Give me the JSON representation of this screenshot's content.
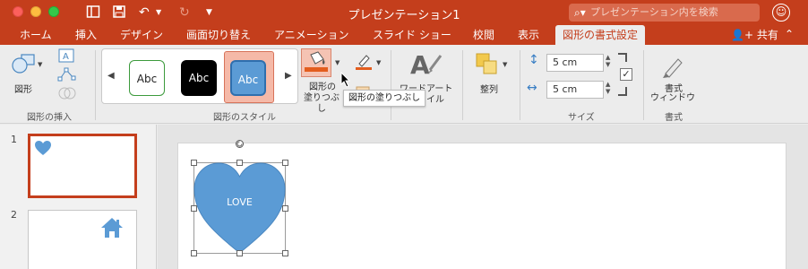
{
  "window": {
    "title": "プレゼンテーション1",
    "search_placeholder": "プレゼンテーション内を検索"
  },
  "tabs": [
    {
      "label": "ホーム"
    },
    {
      "label": "挿入"
    },
    {
      "label": "デザイン"
    },
    {
      "label": "画面切り替え"
    },
    {
      "label": "アニメーション"
    },
    {
      "label": "スライド ショー"
    },
    {
      "label": "校閲"
    },
    {
      "label": "表示"
    },
    {
      "label": "図形の書式設定",
      "active": true
    }
  ],
  "share_label": "共有",
  "ribbon": {
    "insert_group": {
      "shape_label": "図形",
      "group_label": "図形の挿入"
    },
    "styles_group": {
      "tiles": [
        "Abc",
        "Abc",
        "Abc"
      ],
      "fill_label_1": "図形の",
      "fill_label_2": "塗りつぶし",
      "group_label": "図形のスタイル"
    },
    "wordart_label_1": "ワードアート",
    "wordart_label_2": "イル",
    "arrange_label": "整列",
    "size_group": {
      "height": "5 cm",
      "width": "5 cm",
      "group_label": "サイズ"
    },
    "format_pane": {
      "label_1": "書式",
      "label_2": "ウィンドウ",
      "group_label": "書式"
    }
  },
  "tooltip": "図形の塗りつぶし",
  "slides": [
    {
      "number": "1"
    },
    {
      "number": "2"
    }
  ],
  "slide_content": {
    "heart_text": "LOVE"
  },
  "colors": {
    "accent": "#c43e1c",
    "shape_fill": "#5b9bd5",
    "shape_stroke": "#4a87c0"
  }
}
